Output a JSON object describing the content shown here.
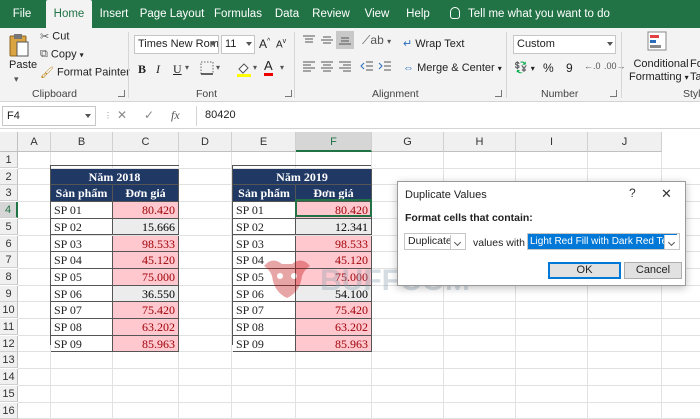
{
  "ribbon_tabs": [
    "File",
    "Home",
    "Insert",
    "Page Layout",
    "Formulas",
    "Data",
    "Review",
    "View",
    "Help"
  ],
  "tell_me": "Tell me what you want to do",
  "clipboard": {
    "paste": "Paste",
    "cut": "Cut",
    "copy": "Copy",
    "format_painter": "Format Painter",
    "label": "Clipboard"
  },
  "font": {
    "name": "Times New Roma",
    "size": "11",
    "label": "Font",
    "bold": "B",
    "italic": "I",
    "underline": "U",
    "grow": "A",
    "shrink": "A",
    "color_letter": "A"
  },
  "alignment": {
    "wrap_text": "Wrap Text",
    "merge_center": "Merge & Center",
    "label": "Alignment"
  },
  "number": {
    "format": "Custom",
    "percent": "%",
    "comma": "9",
    "label": "Number"
  },
  "styles": {
    "conditional": "Conditional",
    "formatting": "Formatting",
    "format_as_1": "Fo",
    "format_as_2": "Ta",
    "label": "Styl"
  },
  "formula_bar": {
    "name_box": "F4",
    "cancel": "✕",
    "enter": "✓",
    "fx": "fx",
    "content": "80420"
  },
  "columns": [
    "A",
    "B",
    "C",
    "D",
    "E",
    "F",
    "G",
    "H",
    "I",
    "J"
  ],
  "rows": [
    "1",
    "2",
    "3",
    "4",
    "5",
    "6",
    "7",
    "8",
    "9",
    "10",
    "11",
    "12",
    "13",
    "14",
    "15",
    "16"
  ],
  "table_2018": {
    "title": "Năm 2018",
    "headers": [
      "Sản phẩm",
      "Đơn giá"
    ],
    "rows": [
      {
        "product": "SP 01",
        "price": "80.420",
        "dup": true
      },
      {
        "product": "SP 02",
        "price": "15.666",
        "dup": false
      },
      {
        "product": "SP 03",
        "price": "98.533",
        "dup": true
      },
      {
        "product": "SP 04",
        "price": "45.120",
        "dup": true
      },
      {
        "product": "SP 05",
        "price": "75.000",
        "dup": true
      },
      {
        "product": "SP 06",
        "price": "36.550",
        "dup": false
      },
      {
        "product": "SP 07",
        "price": "75.420",
        "dup": true
      },
      {
        "product": "SP 08",
        "price": "63.202",
        "dup": true
      },
      {
        "product": "SP 09",
        "price": "85.963",
        "dup": true
      }
    ]
  },
  "table_2019": {
    "title": "Năm 2019",
    "headers": [
      "Sản phẩm",
      "Đơn giá"
    ],
    "rows": [
      {
        "product": "SP 01",
        "price": "80.420",
        "dup": true
      },
      {
        "product": "SP 02",
        "price": "12.341",
        "dup": false
      },
      {
        "product": "SP 03",
        "price": "98.533",
        "dup": true
      },
      {
        "product": "SP 04",
        "price": "45.120",
        "dup": true
      },
      {
        "product": "SP 05",
        "price": "75.000",
        "dup": true
      },
      {
        "product": "SP 06",
        "price": "54.100",
        "dup": false
      },
      {
        "product": "SP 07",
        "price": "75.420",
        "dup": true
      },
      {
        "product": "SP 08",
        "price": "63.202",
        "dup": true
      },
      {
        "product": "SP 09",
        "price": "85.963",
        "dup": true
      }
    ]
  },
  "watermark": "BUFFCOM",
  "dialog": {
    "title": "Duplicate Values",
    "help": "?",
    "close": "✕",
    "label": "Format cells that contain:",
    "type_value": "Duplicate",
    "values_with": "values with",
    "format_value": "Light Red Fill with Dark Red Text",
    "ok": "OK",
    "cancel": "Cancel"
  },
  "colors": {
    "excel_green": "#217346",
    "header_fill": "#203864",
    "dup_fill": "#ffc7ce",
    "dup_text": "#9c0006",
    "unique_fill": "#ececec"
  }
}
